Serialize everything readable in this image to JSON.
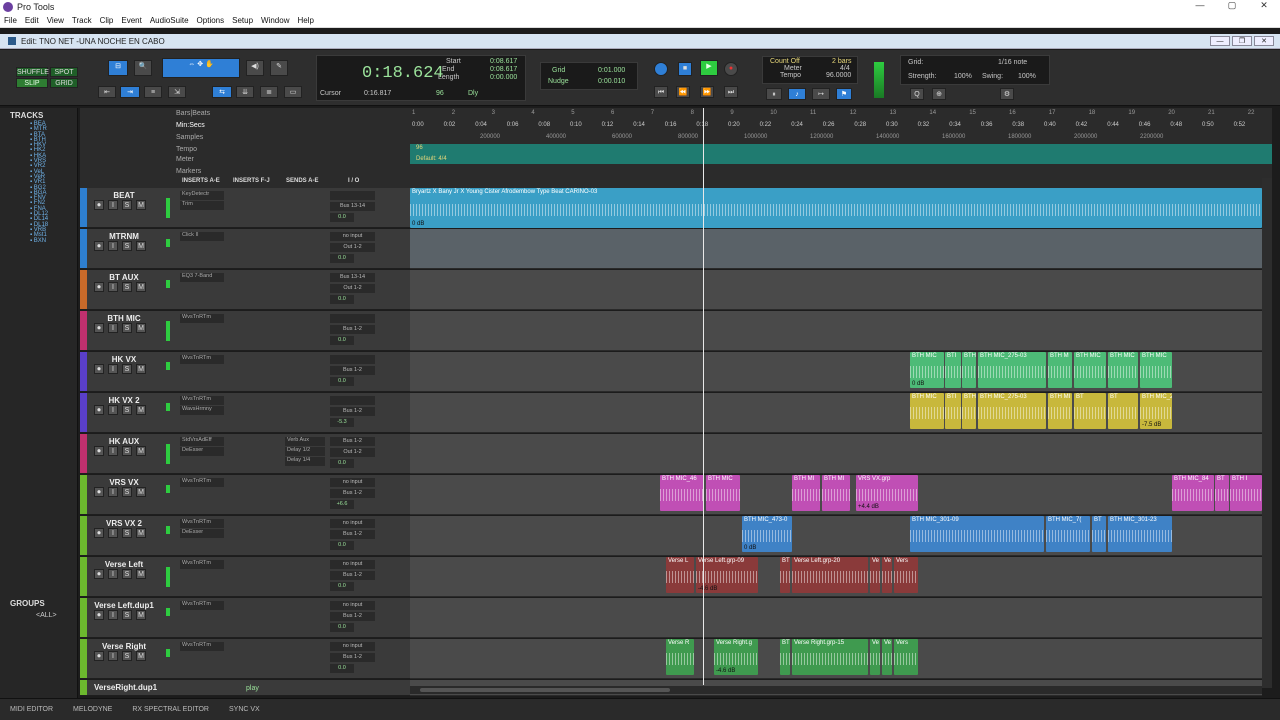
{
  "app": {
    "title": "Pro Tools",
    "window_controls": [
      "—",
      "▢",
      "✕"
    ]
  },
  "menu": [
    "File",
    "Edit",
    "View",
    "Track",
    "Clip",
    "Event",
    "AudioSuite",
    "Options",
    "Setup",
    "Window",
    "Help"
  ],
  "edit_window": {
    "title": "Edit: TNO NET -UNA NOCHE EN CABO"
  },
  "toolbar": {
    "modes": {
      "shuffle": "SHUFFLE",
      "spot": "SPOT",
      "slip": "SLIP",
      "grid": "GRID"
    },
    "main_counter": "0:18.624",
    "cursor_label": "Cursor",
    "cursor_value": "0:16.817",
    "start_label": "Start",
    "start_value": "0:08.617",
    "end_label": "End",
    "end_value": "0:08.617",
    "length_label": "Length",
    "length_value": "0:00.000",
    "grid_label": "Grid",
    "grid_value": "0:01.000",
    "nudge_label": "Nudge",
    "nudge_value": "0:00.010",
    "count_off": "Count Off",
    "meter_label": "Meter",
    "meter_value": "4/4",
    "tempo_label": "Tempo",
    "tempo_value": "96.0000",
    "bars": "2 bars",
    "grid_right_label": "Grid:",
    "note_value": "1/16 note",
    "strength_label": "Strength:",
    "strength_value": "100%",
    "swing_label": "Swing:",
    "swing_value": "100%",
    "dly_label": "Dly",
    "dly_value": "96"
  },
  "left_panel": {
    "tracks_header": "TRACKS",
    "groups_header": "GROUPS",
    "groups_all": "<ALL>",
    "track_list": [
      "BEA",
      "MTR",
      "BTA",
      "BTH",
      "HKV",
      "HK2",
      "HKA",
      "VRS",
      "VR2",
      "VeL",
      "VeR",
      "VR1",
      "BG2",
      "BGA",
      "FNV",
      "FN2",
      "FNA",
      "DL12",
      "DL14",
      "DL18",
      "VRB",
      "Mst1",
      "BXN"
    ]
  },
  "rulers": {
    "bars": "Bars|Beats",
    "min_secs": "Min:Secs",
    "samples": "Samples",
    "tempo": "Tempo",
    "meter": "Meter",
    "markers": "Markers",
    "tempo_marker": "96",
    "meter_marker": "Default: 4/4",
    "bar_ticks": [
      "1",
      "2",
      "3",
      "4",
      "5",
      "6",
      "7",
      "8",
      "9",
      "10",
      "11",
      "12",
      "13",
      "14",
      "15",
      "16",
      "17",
      "18",
      "19",
      "20",
      "21",
      "22"
    ],
    "sec_ticks": [
      "0:00",
      "0:02",
      "0:04",
      "0:06",
      "0:08",
      "0:10",
      "0:12",
      "0:14",
      "0:16",
      "0:18",
      "0:20",
      "0:22",
      "0:24",
      "0:26",
      "0:28",
      "0:30",
      "0:32",
      "0:34",
      "0:36",
      "0:38",
      "0:40",
      "0:42",
      "0:44",
      "0:46",
      "0:48",
      "0:50",
      "0:52"
    ],
    "sample_ticks": [
      "200000",
      "400000",
      "600000",
      "800000",
      "1000000",
      "1200000",
      "1400000",
      "1600000",
      "1800000",
      "2000000",
      "2200000"
    ]
  },
  "columns": {
    "inserts_ae": "INSERTS A-E",
    "inserts_fj": "INSERTS F-J",
    "sends_ae": "SENDS A-E",
    "io": "I / O"
  },
  "tracks": [
    {
      "name": "BEAT",
      "color": "#2e7fd0",
      "insert1": "KeyDetectr",
      "insert2": "Trim",
      "input": "",
      "output": "Bus 13-14",
      "vol": "0.0"
    },
    {
      "name": "MTRNM",
      "color": "#2e7fd0",
      "insert1": "Click II",
      "insert2": "",
      "input": "no input",
      "output": "Out 1-2",
      "vol": "0.0"
    },
    {
      "name": "BT AUX",
      "color": "#c86a2a",
      "insert1": "EQ3 7-Band",
      "insert2": "",
      "input": "Bus 13-14",
      "output": "Out 1-2",
      "vol": "0.0"
    },
    {
      "name": "BTH MIC",
      "color": "#c0306e",
      "insert1": "WvsTnRTm",
      "insert2": "",
      "input": "",
      "output": "Bus 1-2",
      "vol": "0.0"
    },
    {
      "name": "HK VX",
      "color": "#5a3fc8",
      "insert1": "WvsTnRTm",
      "insert2": "",
      "input": "",
      "output": "Bus 1-2",
      "vol": "0.0"
    },
    {
      "name": "HK VX 2",
      "color": "#5a3fc8",
      "insert1": "WvsTnRTm",
      "insert2": "WavsHrmny",
      "input": "",
      "output": "Bus 1-2",
      "vol": "-5.3"
    },
    {
      "name": "HK AUX",
      "color": "#c0306e",
      "insert1": "StdVrsAdEff",
      "insert2": "DeEsser",
      "input": "Bus 1-2",
      "output": "Out 1-2",
      "vol": "0.0",
      "send_a": "Verb Aux",
      "send_b": "Delay 1/2",
      "send_c": "Delay 1/4"
    },
    {
      "name": "VRS VX",
      "color": "#6cb82e",
      "insert1": "WvsTnRTm",
      "insert2": "",
      "input": "no input",
      "output": "Bus 1-2",
      "vol": "+6.6"
    },
    {
      "name": "VRS VX 2",
      "color": "#6cb82e",
      "insert1": "WvsTnRTm",
      "insert2": "DeEsser",
      "input": "no input",
      "output": "Bus 1-2",
      "vol": "0.0"
    },
    {
      "name": "Verse Left",
      "color": "#6cb82e",
      "insert1": "WvsTnRTm",
      "insert2": "",
      "input": "no input",
      "output": "Bus 1-2",
      "vol": "0.0"
    },
    {
      "name": "Verse Left.dup1",
      "color": "#6cb82e",
      "insert1": "WvsTnRTm",
      "insert2": "",
      "input": "no input",
      "output": "Bus 1-2",
      "vol": "0.0"
    },
    {
      "name": "Verse Right",
      "color": "#6cb82e",
      "insert1": "WvsTnRTm",
      "insert2": "",
      "input": "no input",
      "output": "Bus 1-2",
      "vol": "0.0"
    },
    {
      "name": "VerseRight.dup1",
      "color": "#6cb82e",
      "insert1": "WvsTnRTm",
      "insert2": "",
      "input": "no input",
      "output": "",
      "vol": ""
    }
  ],
  "clips": {
    "beat": {
      "name": "Bryartz X Bany Jr X Young Cister Afrodembow Type Beat CARIÑO-03",
      "gain": "0 dB"
    },
    "hk1": [
      "BTH MIC",
      "BTI",
      "BTH",
      "BTH MIC_275-03",
      "BTH M",
      "BTH MIC",
      "BTH MIC",
      "BTH MIC"
    ],
    "hk2": [
      "BTH MIC",
      "BTI",
      "BTH",
      "BTH MIC_275-03",
      "BTH MI",
      "BT",
      "BT",
      "BTH MIC_296-31"
    ],
    "vrs1": [
      "BTH MIC_46",
      "BTH MIC",
      "BTH MI",
      "BTH MI",
      "VRS VX.grp",
      "BTH MIC_84",
      "BT",
      "BTH I"
    ],
    "vrs2": [
      "BTH MIC_473-0",
      "BTH MIC_301-09",
      "BTH MIC_7(",
      "BT",
      "BTH MIC_301-23"
    ],
    "vl1": [
      "Verse L",
      "Verse Left.grp-09",
      "BT",
      "Verse Left.grp-20",
      "Ve",
      "Ve",
      "Vers"
    ],
    "vr": [
      "Verse R",
      "Verse Right.g",
      "BT",
      "Verse Right.grp-15",
      "Ve",
      "Ve",
      "Vers"
    ],
    "gains": [
      "0 dB",
      "-6.",
      "-4.6 dB",
      "-2.8",
      "-7.5 dB",
      "+4.4",
      "+4.4 dB",
      "-2.0 dB"
    ]
  },
  "bottom_bar": [
    "MIDI EDITOR",
    "MELODYNE",
    "RX SPECTRAL EDITOR",
    "SYNC VX"
  ],
  "play_label": "play"
}
